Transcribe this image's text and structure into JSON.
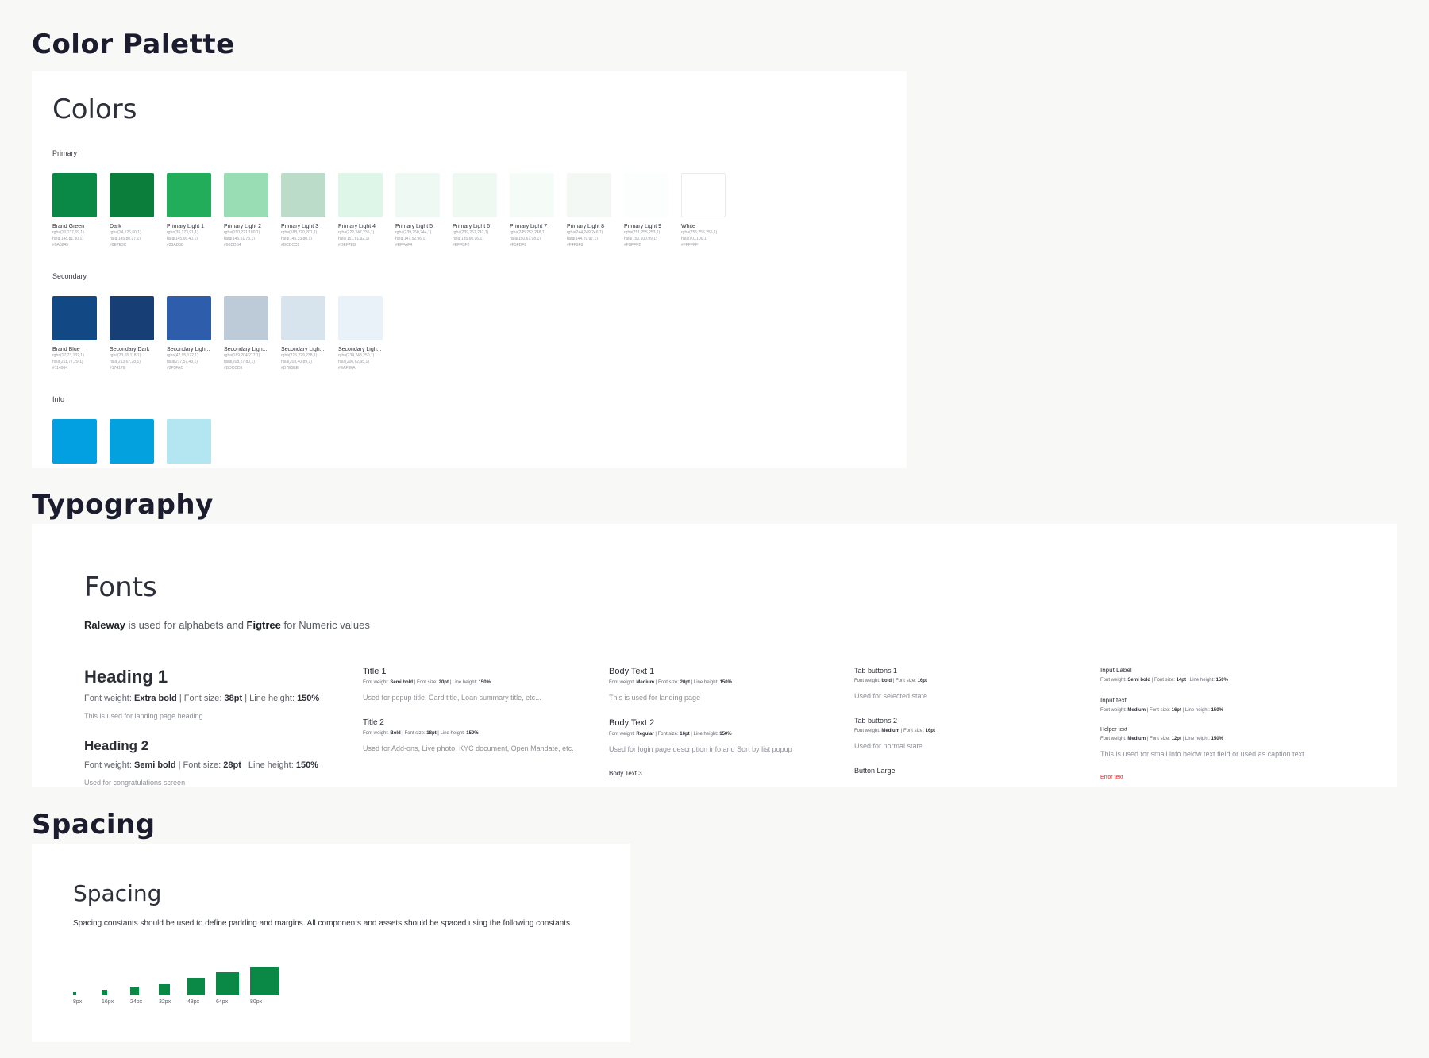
{
  "sections": {
    "palette": "Color Palette",
    "typography": "Typography",
    "spacing": "Spacing"
  },
  "colors": {
    "title": "Colors",
    "groups": [
      {
        "label": "Primary",
        "swatches": [
          {
            "name": "Brand Green",
            "rgba": "rgba(10,137,69,1)",
            "hsla": "hsla(148,81,30,1)",
            "hex": "#0A8845",
            "color": "#0a8845"
          },
          {
            "name": "Dark",
            "rgba": "rgba(14,126,60,1)",
            "hsla": "hsla(145,80,27,1)",
            "hex": "#0E7E3C",
            "color": "#0b7e3c"
          },
          {
            "name": "Primary Light 1",
            "rgba": "rgba(35,173,91,1)",
            "hsla": "hsla(145,66,40,1)",
            "hex": "#23AD5B",
            "color": "#21ad5a"
          },
          {
            "name": "Primary Light 2",
            "rgba": "rgba(150,221,180,1)",
            "hsla": "hsla(145,51,73,1)",
            "hex": "#96DDB4",
            "color": "#98ddb3"
          },
          {
            "name": "Primary Light 3",
            "rgba": "rgba(188,220,201,1)",
            "hsla": "hsla(145,33,80,1)",
            "hex": "#BCDCC9",
            "color": "#bcdcca"
          },
          {
            "name": "Primary Light 4",
            "rgba": "rgba(222,247,235,1)",
            "hsla": "hsla(151,81,92,1)",
            "hex": "#DEF7EB",
            "color": "#ddf6e8"
          },
          {
            "name": "Primary Light 5",
            "rgba": "rgba(239,250,244,1)",
            "hsla": "hsla(147,52,96,1)",
            "hex": "#EFFAF4",
            "color": "#eff9f3"
          },
          {
            "name": "Primary Light 6",
            "rgba": "rgba(239,251,242,1)",
            "hsla": "hsla(135,60,96,1)",
            "hex": "#EFFBF2",
            "color": "#eefaf1"
          },
          {
            "name": "Primary Light 7",
            "rgba": "rgba(245,253,248,1)",
            "hsla": "hsla(150,67,98,1)",
            "hex": "#F5FDF8",
            "color": "#f5fcf7"
          },
          {
            "name": "Primary Light 8",
            "rgba": "rgba(244,249,246,1)",
            "hsla": "hsla(144,29,97,1)",
            "hex": "#F4F9F6",
            "color": "#f3f8f4"
          },
          {
            "name": "Primary Light 9",
            "rgba": "rgba(251,255,253,1)",
            "hsla": "hsla(150,100,99,1)",
            "hex": "#FBFFFD",
            "color": "#fbfefd"
          },
          {
            "name": "White",
            "rgba": "rgba(255,255,255,1)",
            "hsla": "hsla(0,0,100,1)",
            "hex": "#FFFFFF",
            "color": "#ffffff"
          }
        ]
      },
      {
        "label": "Secondary",
        "swatches": [
          {
            "name": "Brand Blue",
            "rgba": "rgba(17,73,132,1)",
            "hsla": "hsla(211,77,29,1)",
            "hex": "#114984",
            "color": "#124985"
          },
          {
            "name": "Secondary Dark",
            "rgba": "rgba(23,65,118,1)",
            "hsla": "hsla(213,67,28,1)",
            "hex": "#174176",
            "color": "#173f76"
          },
          {
            "name": "Secondary Ligh...",
            "rgba": "rgba(47,95,172,1)",
            "hsla": "hsla(217,57,43,1)",
            "hex": "#2F5FAC",
            "color": "#2e5dab"
          },
          {
            "name": "Secondary Ligh...",
            "rgba": "rgba(189,204,217,1)",
            "hsla": "hsla(208,27,80,1)",
            "hex": "#BDCCD9",
            "color": "#bdcad8"
          },
          {
            "name": "Secondary Ligh...",
            "rgba": "rgba(215,229,238,1)",
            "hsla": "hsla(203,40,89,1)",
            "hex": "#D7E5EE",
            "color": "#d7e4ee"
          },
          {
            "name": "Secondary Ligh...",
            "rgba": "rgba(234,243,250,1)",
            "hsla": "hsla(206,62,95,1)",
            "hex": "#EAF3FA",
            "color": "#e9f2f9"
          }
        ]
      },
      {
        "label": "Info",
        "swatches": [
          {
            "name": "",
            "color": "#02a0e1"
          },
          {
            "name": "",
            "color": "#03a2df"
          },
          {
            "name": "",
            "color": "#b3e6f0"
          }
        ]
      }
    ]
  },
  "typography": {
    "title": "Fonts",
    "sub_font1": "Raleway",
    "sub_mid": " is used for alphabets and ",
    "sub_font2": "Figtree",
    "sub_end": " for Numeric values",
    "columns": [
      [
        {
          "title": "Heading 1",
          "size": 22,
          "weight": "Extra bold",
          "font_size": "38pt",
          "line_height": "150%",
          "desc": "This is used for landing page heading",
          "big": true
        },
        {
          "title": "Heading 2",
          "size": 17,
          "weight": "Semi bold",
          "font_size": "28pt",
          "line_height": "150%",
          "desc": "Used for congratulations screen",
          "big": true
        }
      ],
      [
        {
          "title": "Title 1",
          "size": 11,
          "weight": "Semi bold",
          "font_size": "20pt",
          "line_height": "150%",
          "desc": "Used for popup title, Card title, Loan summary title, etc..."
        },
        {
          "title": "Title 2",
          "size": 10,
          "weight": "Bold",
          "font_size": "18pt",
          "line_height": "150%",
          "desc": "Used for Add-ons, Live photo, KYC document, Open Mandate, etc."
        }
      ],
      [
        {
          "title": "Body Text 1",
          "size": 11,
          "weight": "Medium",
          "font_size": "20pt",
          "line_height": "150%",
          "desc": "This is used for landing page"
        },
        {
          "title": "Body Text 2",
          "size": 11,
          "weight": "Regular",
          "font_size": "16pt",
          "line_height": "150%",
          "desc": "Used for login page description info and Sort by list popup"
        },
        {
          "title": "Body Text 3",
          "size": 8
        }
      ],
      [
        {
          "title": "Tab buttons 1",
          "size": 9,
          "weight": "bold",
          "font_size": "16pt",
          "desc": "Used for selected state"
        },
        {
          "title": "Tab buttons 2",
          "size": 9,
          "weight": "Medium",
          "font_size": "16pt",
          "desc": "Used for normal state"
        },
        {
          "title": "Button Large",
          "size": 9
        }
      ],
      [
        {
          "title": "Input Label",
          "size": 8,
          "weight": "Semi bold",
          "font_size": "14pt",
          "line_height": "150%"
        },
        {
          "title": "Input text",
          "size": 8,
          "weight": "Medium",
          "font_size": "16pt",
          "line_height": "150%"
        },
        {
          "title": "Helper text",
          "size": 7,
          "weight": "Medium",
          "font_size": "12pt",
          "line_height": "150%",
          "desc": "This is used for small info below text field or used as caption text"
        }
      ]
    ],
    "error_text": "Error text",
    "labels": {
      "font_weight": "Font weight: ",
      "font_size": "Font size: ",
      "line_height": "Line height: "
    }
  },
  "spacing": {
    "title": "Spacing",
    "description": "Spacing constants should be used to define padding and margins. All components and assets should be spaced using the following constants.",
    "items": [
      {
        "label": "8px",
        "value": 8
      },
      {
        "label": "16px",
        "value": 16
      },
      {
        "label": "24px",
        "value": 24
      },
      {
        "label": "32px",
        "value": 32
      },
      {
        "label": "48px",
        "value": 48
      },
      {
        "label": "64px",
        "value": 64
      },
      {
        "label": "80px",
        "value": 80
      }
    ],
    "box_color": "#0a8845"
  }
}
